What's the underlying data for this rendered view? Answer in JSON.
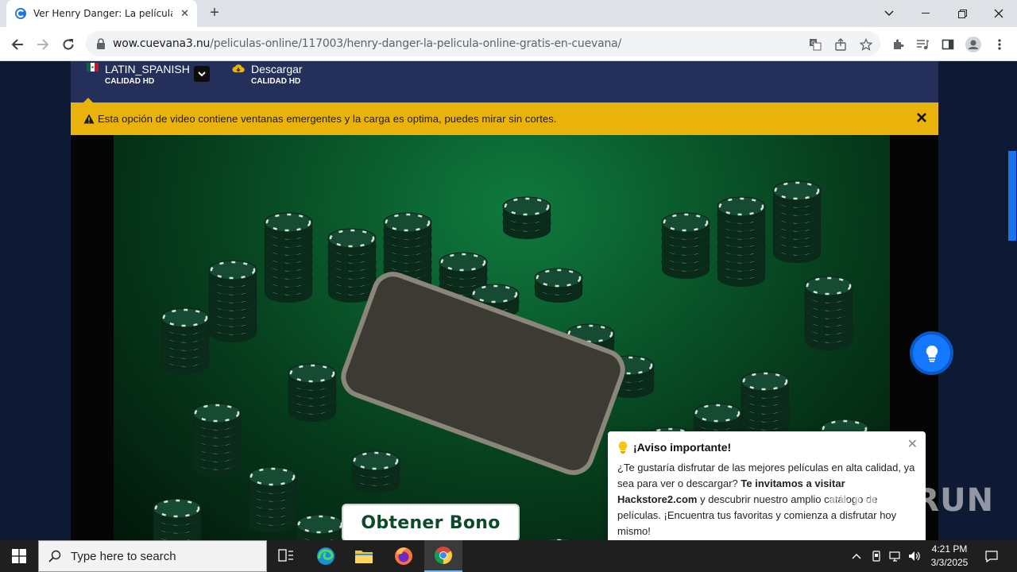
{
  "browser": {
    "tab_title": "Ver Henry Danger: La película Online",
    "url_host": "wow.cuevana3.nu",
    "url_path": "/peliculas-online/117003/henry-danger-la-pelicula-online-gratis-en-cuevana/"
  },
  "player": {
    "options": [
      {
        "name": "LATIN_SPANISH",
        "quality": "CALIDAD HD"
      },
      {
        "name": "Descargar",
        "quality": "CALIDAD HD"
      }
    ],
    "warning": "Esta opción de video contiene ventanas emergentes y la carga es optima, puedes mirar sin cortes.",
    "bonus_button": "Obtener Bono"
  },
  "notice": {
    "title": "¡Aviso importante!",
    "text_1": "¿Te gustaría disfrutar de las mejores películas en alta calidad, ya sea para ver o descargar?",
    "text_bold": "Te invitamos a visitar Hackstore2.com",
    "text_2": "y descubrir nuestro amplio catálogo de películas. ¡Encuentra tus favoritas y comienza a disfrutar hoy mismo!"
  },
  "watermark": "ANY RUN",
  "taskbar": {
    "search_placeholder": "Type here to search",
    "time": "4:21 PM",
    "date": "3/3/2025"
  },
  "colors": {
    "page_bg": "#0e1a33",
    "player_bar": "#242f5a",
    "warning_bar": "#e9b30c",
    "fab": "#1677ff",
    "scroll_thumb": "#1a73e8"
  }
}
